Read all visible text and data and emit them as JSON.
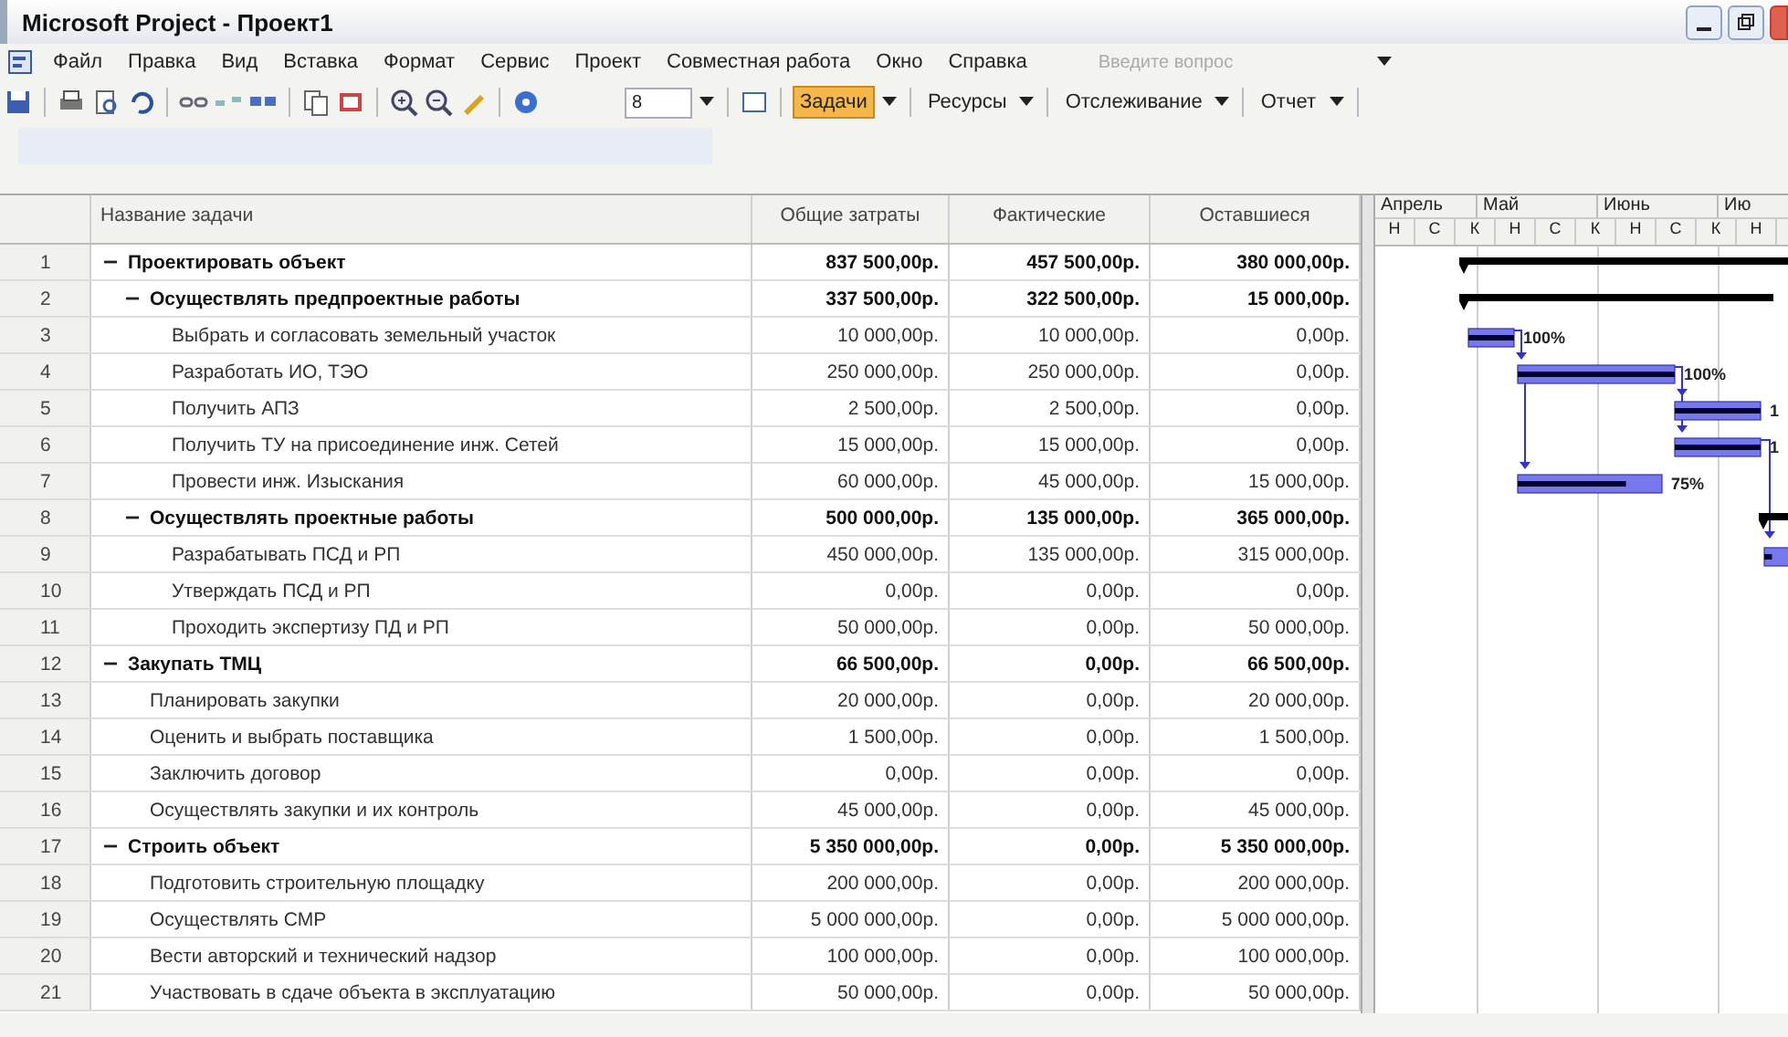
{
  "window": {
    "title": "Microsoft Project - Проект1"
  },
  "menu": [
    "Файл",
    "Правка",
    "Вид",
    "Вставка",
    "Формат",
    "Сервис",
    "Проект",
    "Совместная работа",
    "Окно",
    "Справка"
  ],
  "help_search": {
    "placeholder": "Введите вопрос"
  },
  "toolbar": {
    "font_size": "8",
    "views": [
      {
        "label": "Задачи",
        "selected": true
      },
      {
        "label": "Ресурсы",
        "selected": false
      },
      {
        "label": "Отслеживание",
        "selected": false
      },
      {
        "label": "Отчет",
        "selected": false
      }
    ]
  },
  "table": {
    "columns": [
      "Название задачи",
      "Общие затраты",
      "Фактические",
      "Оставшиеся"
    ],
    "tasks": [
      {
        "id": "1",
        "name": "Проектировать объект",
        "total": "837 500,00р.",
        "actual": "457 500,00р.",
        "remaining": "380 000,00р.",
        "expanded": true,
        "gantt": {
          "kind": "summary"
        },
        "children": [
          {
            "id": "2",
            "name": "Осуществлять предпроектные работы",
            "total": "337 500,00р.",
            "actual": "322 500,00р.",
            "remaining": "15 000,00р.",
            "expanded": true,
            "gantt": {
              "kind": "summary"
            },
            "children": [
              {
                "id": "3",
                "name": "Выбрать и согласовать земельный участок",
                "total": "10 000,00р.",
                "actual": "10 000,00р.",
                "remaining": "0,00р.",
                "gantt": {
                  "kind": "task",
                  "level": 1,
                  "label": "100%"
                }
              },
              {
                "id": "4",
                "name": "Разработать ИО, ТЭО",
                "total": "250 000,00р.",
                "actual": "250 000,00р.",
                "remaining": "0,00р.",
                "gantt": {
                  "kind": "task",
                  "level": 1,
                  "label": "100%"
                }
              },
              {
                "id": "5",
                "name": "Получить АПЗ",
                "total": "2 500,00р.",
                "actual": "2 500,00р.",
                "remaining": "0,00р.",
                "gantt": {
                  "kind": "task",
                  "level": 1,
                  "label": "1"
                }
              },
              {
                "id": "6",
                "name": "Получить ТУ на присоединение инж. Сетей",
                "total": "15 000,00р.",
                "actual": "15 000,00р.",
                "remaining": "0,00р.",
                "gantt": {
                  "kind": "task",
                  "level": 1,
                  "label": "1"
                }
              },
              {
                "id": "7",
                "name": "Провести инж. Изыскания",
                "total": "60 000,00р.",
                "actual": "45 000,00р.",
                "remaining": "15 000,00р.",
                "gantt": {
                  "kind": "task",
                  "level": 0.75,
                  "label": "75%"
                }
              }
            ]
          },
          {
            "id": "8",
            "name": "Осуществлять проектные работы",
            "total": "500 000,00р.",
            "actual": "135 000,00р.",
            "remaining": "365 000,00р.",
            "expanded": true,
            "gantt": {
              "kind": "summary"
            },
            "children": [
              {
                "id": "9",
                "name": "Разрабатывать ПСД и РП",
                "total": "450 000,00р.",
                "actual": "135 000,00р.",
                "remaining": "315 000,00р.",
                "gantt": {
                  "kind": "task",
                  "level": 0.3
                }
              },
              {
                "id": "10",
                "name": "Утверждать ПСД и РП",
                "total": "0,00р.",
                "actual": "0,00р.",
                "remaining": "0,00р."
              },
              {
                "id": "11",
                "name": "Проходить экспертизу ПД и РП",
                "total": "50 000,00р.",
                "actual": "0,00р.",
                "remaining": "50 000,00р."
              }
            ]
          }
        ]
      },
      {
        "id": "12",
        "name": "Закупать ТМЦ",
        "total": "66 500,00р.",
        "actual": "0,00р.",
        "remaining": "66 500,00р.",
        "expanded": true,
        "children": [
          {
            "id": "13",
            "name": "Планировать закупки",
            "total": "20 000,00р.",
            "actual": "0,00р.",
            "remaining": "20 000,00р."
          },
          {
            "id": "14",
            "name": "Оценить и выбрать поставщика",
            "total": "1 500,00р.",
            "actual": "0,00р.",
            "remaining": "1 500,00р."
          },
          {
            "id": "15",
            "name": "Заключить договор",
            "total": "0,00р.",
            "actual": "0,00р.",
            "remaining": "0,00р."
          },
          {
            "id": "16",
            "name": "Осуществлять закупки и их контроль",
            "total": "45 000,00р.",
            "actual": "0,00р.",
            "remaining": "45 000,00р."
          }
        ]
      },
      {
        "id": "17",
        "name": "Строить объект",
        "total": "5 350 000,00р.",
        "actual": "0,00р.",
        "remaining": "5 350 000,00р.",
        "expanded": true,
        "children": [
          {
            "id": "18",
            "name": "Подготовить строительную площадку",
            "total": "200 000,00р.",
            "actual": "0,00р.",
            "remaining": "200 000,00р."
          },
          {
            "id": "19",
            "name": "Осуществлять СМР",
            "total": "5 000 000,00р.",
            "actual": "0,00р.",
            "remaining": "5 000 000,00р."
          },
          {
            "id": "20",
            "name": "Вести авторский и технический надзор",
            "total": "100 000,00р.",
            "actual": "0,00р.",
            "remaining": "100 000,00р."
          },
          {
            "id": "21",
            "name": "Участвовать в сдаче объекта в эксплуатацию",
            "total": "50 000,00р.",
            "actual": "0,00р.",
            "remaining": "50 000,00р."
          }
        ]
      }
    ]
  },
  "timescale": {
    "months": [
      "Апрель",
      "Май",
      "Июнь",
      "Ию"
    ],
    "units": [
      "Н",
      "С",
      "К",
      "Н",
      "С",
      "К",
      "Н",
      "С",
      "К",
      "Н"
    ]
  }
}
